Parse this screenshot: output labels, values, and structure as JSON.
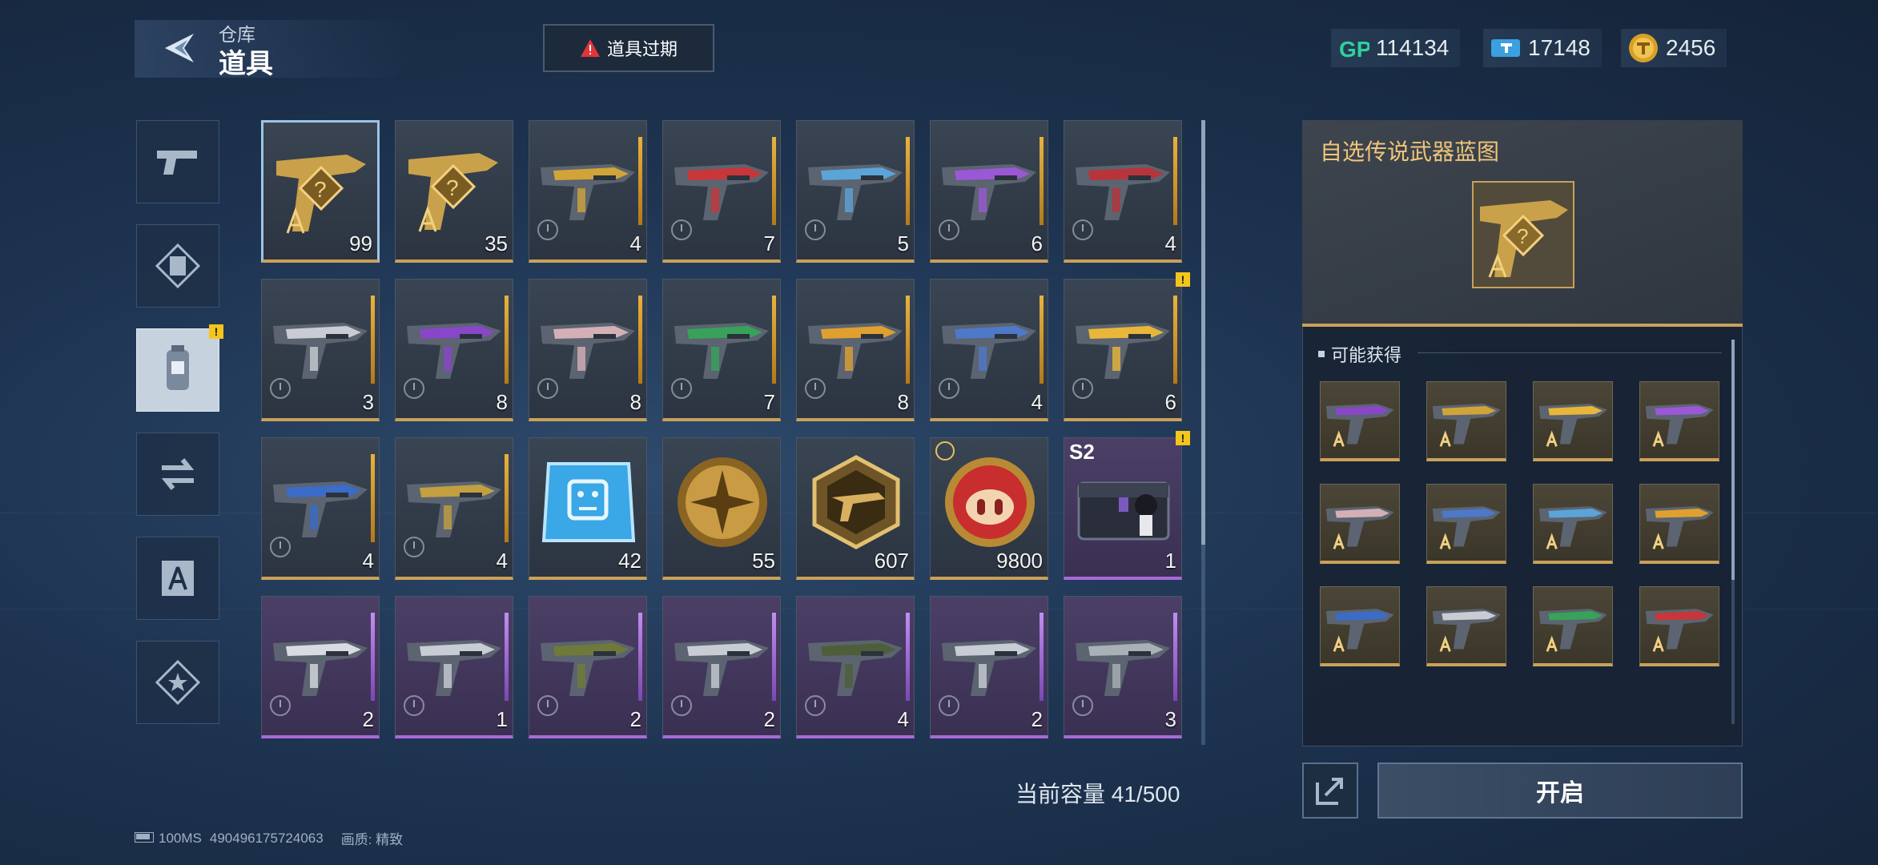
{
  "header": {
    "subtitle": "仓库",
    "title": "道具",
    "expire_button_label": "道具过期"
  },
  "currencies": [
    {
      "icon": "gp-icon",
      "value": "114134"
    },
    {
      "icon": "ticket-icon",
      "value": "17148"
    },
    {
      "icon": "gold-coin-icon",
      "value": "2456"
    }
  ],
  "sidebar": {
    "tabs": [
      {
        "icon": "pistol-icon"
      },
      {
        "icon": "frame-icon"
      },
      {
        "icon": "consumable-icon",
        "active": true,
        "badge": "!"
      },
      {
        "icon": "swap-icon"
      },
      {
        "icon": "blueprint-icon"
      },
      {
        "icon": "star-icon"
      }
    ]
  },
  "inventory": {
    "items": [
      {
        "type": "blueprint",
        "qty": "99",
        "rarity": "gold",
        "selected": true
      },
      {
        "type": "blueprint",
        "qty": "35",
        "rarity": "gold"
      },
      {
        "type": "weapon",
        "qty": "4",
        "rarity": "gold",
        "accent": "#d1a43a"
      },
      {
        "type": "weapon",
        "qty": "7",
        "rarity": "gold",
        "accent": "#c9363a"
      },
      {
        "type": "weapon",
        "qty": "5",
        "rarity": "gold",
        "accent": "#5aa4d8"
      },
      {
        "type": "weapon",
        "qty": "6",
        "rarity": "gold",
        "accent": "#9b58d6"
      },
      {
        "type": "weapon",
        "qty": "4",
        "rarity": "gold",
        "accent": "#b8343a"
      },
      {
        "type": "weapon",
        "qty": "3",
        "rarity": "gold",
        "accent": "#c9ccd2"
      },
      {
        "type": "weapon",
        "qty": "8",
        "rarity": "gold",
        "accent": "#8a46c9"
      },
      {
        "type": "weapon",
        "qty": "8",
        "rarity": "gold",
        "accent": "#d4b0b6"
      },
      {
        "type": "weapon",
        "qty": "7",
        "rarity": "gold",
        "accent": "#38a25a"
      },
      {
        "type": "weapon",
        "qty": "8",
        "rarity": "gold",
        "accent": "#e0a030"
      },
      {
        "type": "weapon",
        "qty": "4",
        "rarity": "gold",
        "accent": "#4e78c8"
      },
      {
        "type": "weapon",
        "qty": "6",
        "rarity": "gold",
        "accent": "#e8b73a",
        "badge": "!"
      },
      {
        "type": "weapon",
        "qty": "4",
        "rarity": "gold",
        "accent": "#3a6cc8"
      },
      {
        "type": "weapon",
        "qty": "4",
        "rarity": "gold",
        "accent": "#c2a040"
      },
      {
        "type": "chip",
        "qty": "42",
        "rarity": "gold"
      },
      {
        "type": "medal",
        "qty": "55",
        "rarity": "gold"
      },
      {
        "type": "badge",
        "qty": "607",
        "rarity": "gold"
      },
      {
        "type": "pig-coin",
        "qty": "9800",
        "rarity": "gold",
        "timed": true
      },
      {
        "type": "crate",
        "qty": "1",
        "rarity": "purple",
        "season": "S2",
        "badge": "!"
      },
      {
        "type": "weapon",
        "qty": "2",
        "rarity": "purple",
        "accent": "#d8dce2"
      },
      {
        "type": "weapon",
        "qty": "1",
        "rarity": "purple",
        "accent": "#c8ccd4"
      },
      {
        "type": "weapon",
        "qty": "2",
        "rarity": "purple",
        "accent": "#6f7a3a"
      },
      {
        "type": "weapon",
        "qty": "2",
        "rarity": "purple",
        "accent": "#c8ccd4"
      },
      {
        "type": "weapon",
        "qty": "4",
        "rarity": "purple",
        "accent": "#4e5e3a"
      },
      {
        "type": "weapon",
        "qty": "2",
        "rarity": "purple",
        "accent": "#c8ccd4"
      },
      {
        "type": "weapon",
        "qty": "3",
        "rarity": "purple",
        "accent": "#aab0b8"
      }
    ],
    "capacity_label": "当前容量 41/500"
  },
  "detail": {
    "title": "自选传说武器蓝图",
    "obtainable_label": "可能获得",
    "obtainable_items": [
      {
        "accent": "#8a46c9"
      },
      {
        "accent": "#d1a43a"
      },
      {
        "accent": "#e8b73a"
      },
      {
        "accent": "#9b58d6"
      },
      {
        "accent": "#d4b0b6"
      },
      {
        "accent": "#4e78c8"
      },
      {
        "accent": "#5aa4d8"
      },
      {
        "accent": "#e0a030"
      },
      {
        "accent": "#3a6cc8"
      },
      {
        "accent": "#c9ccd2"
      },
      {
        "accent": "#38a25a"
      },
      {
        "accent": "#c9363a"
      }
    ],
    "open_button_label": "开启"
  },
  "footer": {
    "ping": "100MS",
    "uid": "490496175724063",
    "quality": "画质: 精致"
  }
}
